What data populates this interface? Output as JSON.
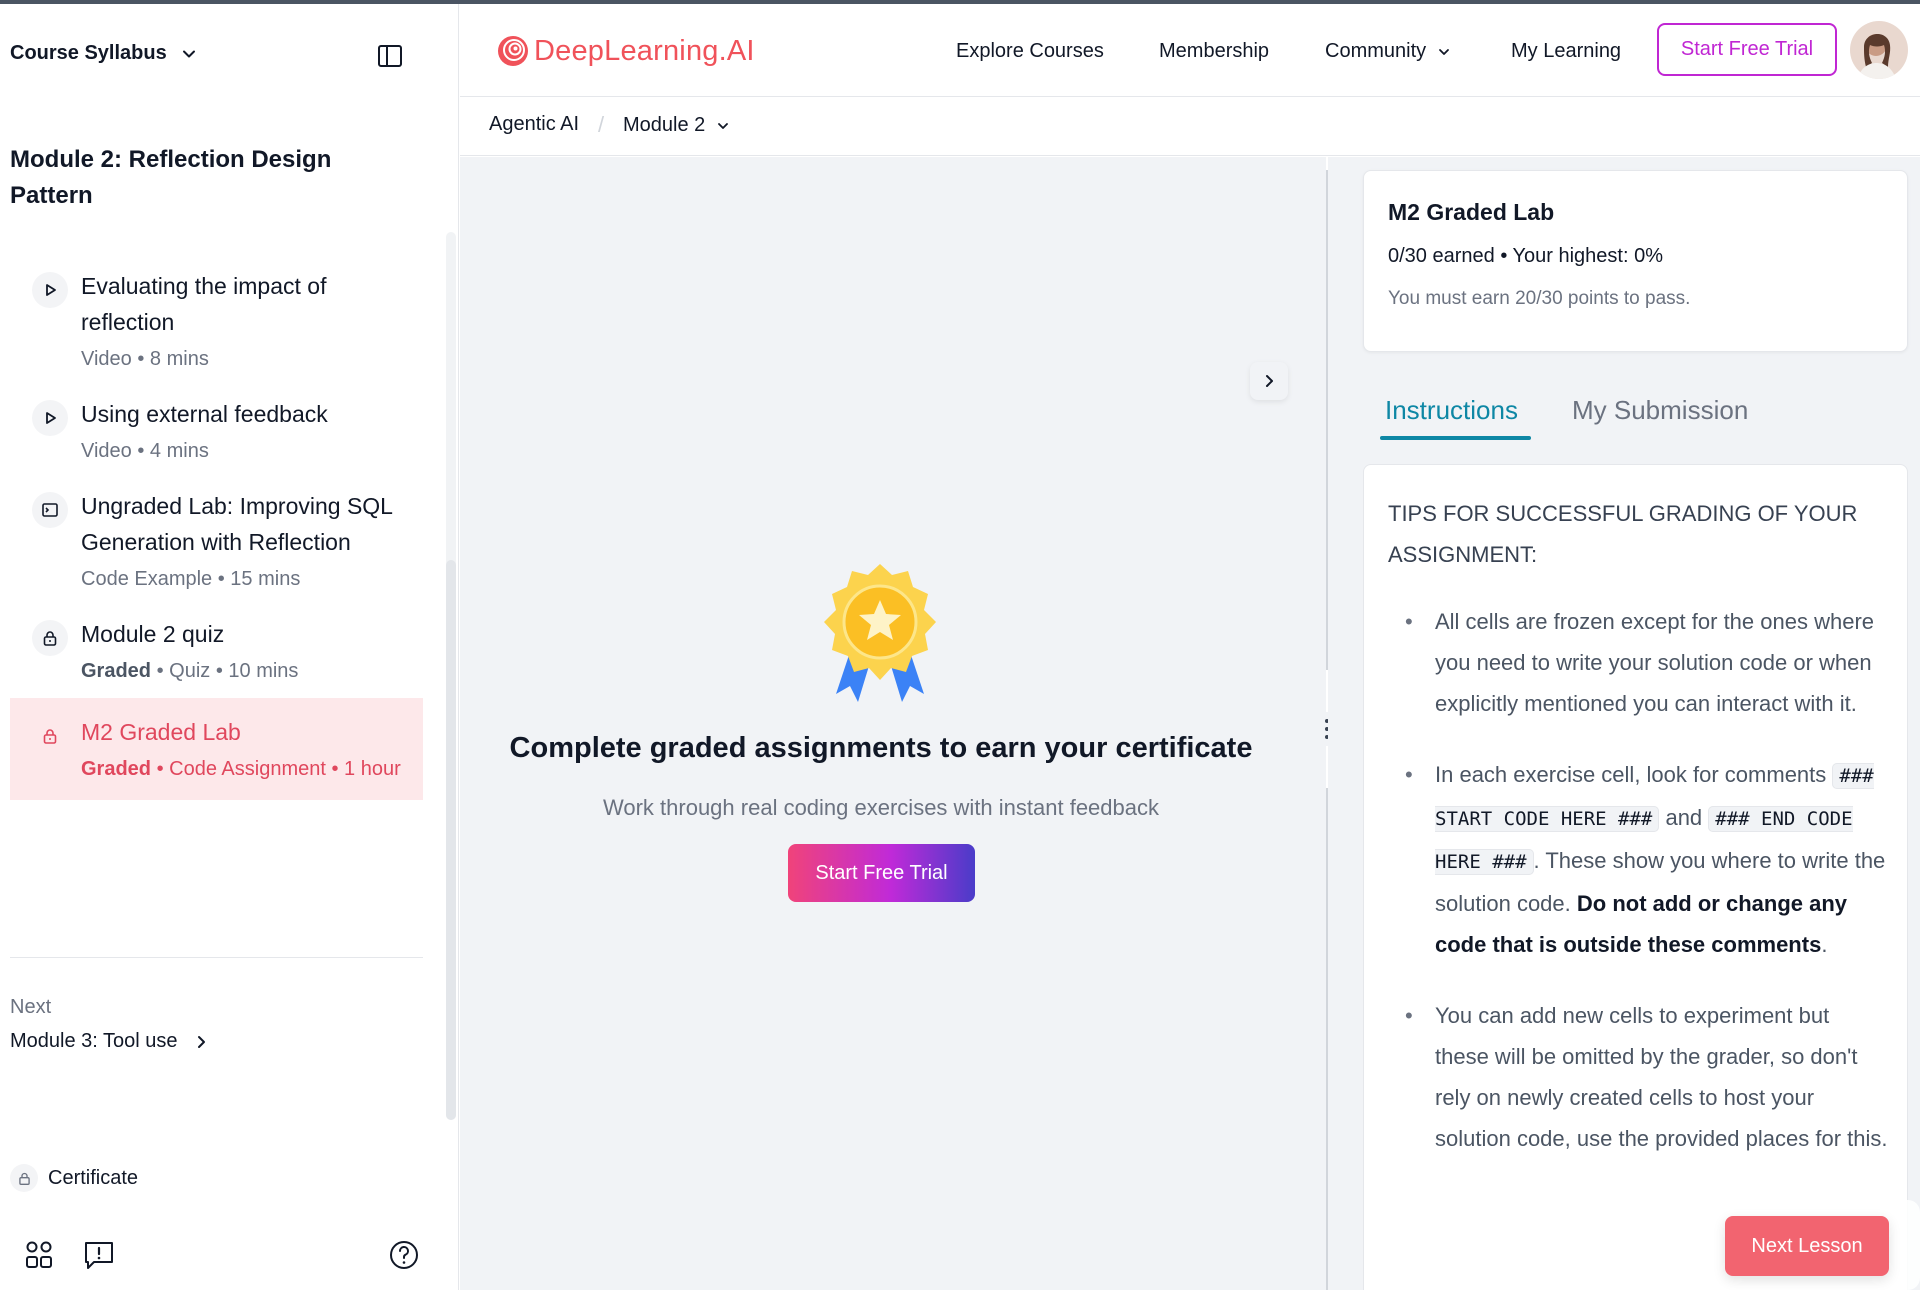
{
  "sidebar": {
    "syllabus_title": "Course Syllabus",
    "module_title": "Module 2: Reflection Design Pattern",
    "lessons": [
      {
        "title": "Evaluating the impact of reflection",
        "graded": "",
        "meta": "Video • 8 mins",
        "icon": "play-icon"
      },
      {
        "title": "Using external feedback",
        "graded": "",
        "meta": "Video • 4 mins",
        "icon": "play-icon"
      },
      {
        "title": "Ungraded Lab: Improving SQL Generation with Reflection",
        "graded": "",
        "meta": "Code Example • 15 mins",
        "icon": "code-window-icon"
      },
      {
        "title": "Module 2 quiz",
        "graded": "Graded",
        "meta": " • Quiz • 10 mins",
        "icon": "lock-icon"
      },
      {
        "title": "M2 Graded Lab",
        "graded": "Graded",
        "meta": " • Code Assignment • 1 hour",
        "icon": "lock-icon",
        "active": true
      }
    ],
    "next_label": "Next",
    "next_module": "Module 3: Tool use",
    "certificate": "Certificate"
  },
  "header": {
    "logo_text": "DeepLearning.AI",
    "nav": {
      "explore": "Explore Courses",
      "membership": "Membership",
      "community": "Community",
      "my_learning": "My Learning"
    },
    "trial_button": "Start Free Trial"
  },
  "breadcrumb": {
    "course": "Agentic AI",
    "module": "Module 2"
  },
  "main": {
    "cta_title": "Complete graded assignments to earn your certificate",
    "cta_subtitle": "Work through real coding exercises with instant feedback",
    "cta_button": "Start Free Trial"
  },
  "lab": {
    "title": "M2 Graded Lab",
    "earned": "0/30 earned • Your highest: 0%",
    "pass_text": "You must earn 20/30 points to pass."
  },
  "tabs": {
    "instructions": "Instructions",
    "submission": "My Submission",
    "active": "Instructions"
  },
  "instructions": {
    "heading": "TIPS FOR SUCCESSFUL GRADING OF YOUR ASSIGNMENT:",
    "tip1": "All cells are frozen except for the ones where you need to write your solution code or when explicitly mentioned you can interact with it.",
    "tip2_a": "In each exercise cell, look for comments ",
    "tip2_code1": "### START CODE HERE ###",
    "tip2_b": " and ",
    "tip2_code2": "### END CODE HERE ###",
    "tip2_c": ". These show you where to write the solution code. ",
    "tip2_bold": "Do not add or change any code that is outside these comments",
    "tip2_d": ".",
    "tip3": "You can add new cells to experiment but these will be omitted by the grader, so don't rely on newly created cells to host your solution code, use the provided places for this."
  },
  "next_lesson_button": "Next Lesson",
  "colors": {
    "brand": "#f0525a",
    "accent_tab": "#0e87a5",
    "trial_border": "#c026d3",
    "active_lesson_bg": "#fde8ea",
    "next_lesson_bg": "#f26470"
  }
}
